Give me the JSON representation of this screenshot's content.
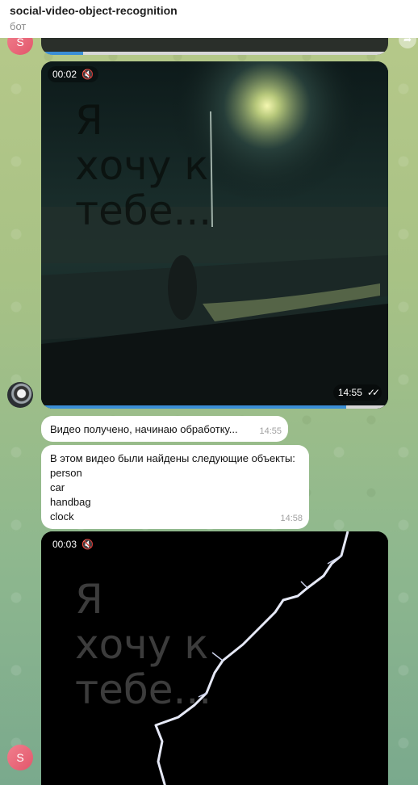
{
  "header": {
    "title": "social-video-object-recognition",
    "subtitle": "бот"
  },
  "avatars": {
    "bot_letter": "S"
  },
  "video_1": {
    "duration": "00:02",
    "overlay_lines": [
      "Я",
      "хочу к",
      "тебе..."
    ],
    "time": "14:55",
    "progress_fraction": 0.88
  },
  "top_video_progress_fraction": 0.12,
  "messages": {
    "received": {
      "text": "Видео получено, начинаю обработку...",
      "time": "14:55"
    },
    "result": {
      "heading": "В этом видео были найдены следующие объекты:",
      "objects": [
        "person",
        "car",
        "handbag",
        "clock"
      ],
      "time": "14:58"
    }
  },
  "video_2": {
    "duration": "00:03",
    "overlay_lines": [
      "Я",
      "хочу к",
      "тебе..."
    ]
  },
  "icons": {
    "mute": "mute-icon",
    "read": "double-check-icon",
    "share": "share-icon"
  }
}
